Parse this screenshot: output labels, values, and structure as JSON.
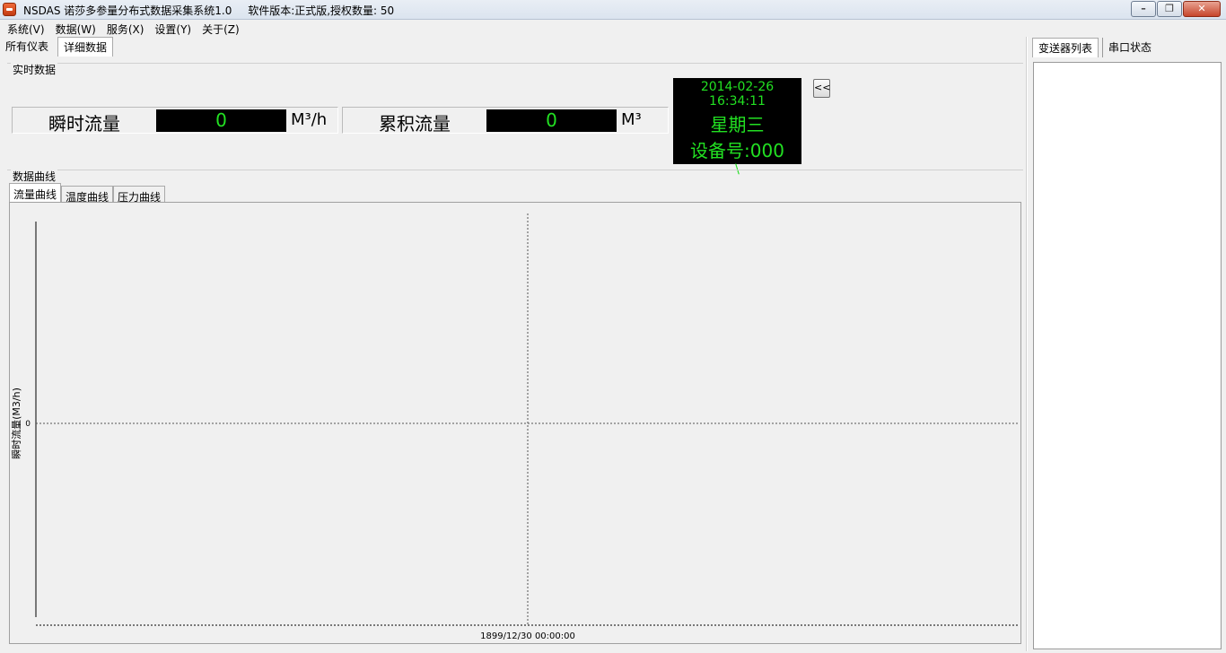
{
  "window": {
    "title": "NSDAS 诺莎多参量分布式数据采集系统1.0",
    "version_info": "软件版本:正式版,授权数量: 50",
    "minimize_glyph": "–",
    "maximize_glyph": "❐",
    "close_glyph": "✕"
  },
  "menu": [
    "系统(V)",
    "数据(W)",
    "服务(X)",
    "设置(Y)",
    "关于(Z)"
  ],
  "main_tabs": [
    {
      "label": "所有仪表",
      "active": false
    },
    {
      "label": "详细数据",
      "active": true
    }
  ],
  "realtime": {
    "legend": "实时数据",
    "instant_flow": {
      "label": "瞬时流量",
      "value": "0",
      "unit": "M³/h"
    },
    "total_flow": {
      "label": "累积流量",
      "value": "0",
      "unit": "M³"
    },
    "clock": {
      "datetime": "2014-02-26 16:34:11",
      "weekday": "星期三",
      "device": "设备号:000",
      "spinner": "\\"
    },
    "collapse_button": "<<"
  },
  "curves": {
    "legend": "数据曲线",
    "tabs": [
      {
        "label": "流量曲线",
        "active": true
      },
      {
        "label": "温度曲线",
        "active": false
      },
      {
        "label": "压力曲线",
        "active": false
      }
    ]
  },
  "chart_data": {
    "type": "line",
    "ylabel": "瞬时流量(M3/h)",
    "y_ticks": [
      "0"
    ],
    "x_ticks": [
      "1899/12/30 00:00:00"
    ],
    "series": [],
    "grid": true,
    "colors": {
      "axis": "#000000",
      "grid": "#555555"
    }
  },
  "right_tabs": [
    {
      "label": "变送器列表",
      "active": true
    },
    {
      "label": "串口状态",
      "active": false
    }
  ]
}
